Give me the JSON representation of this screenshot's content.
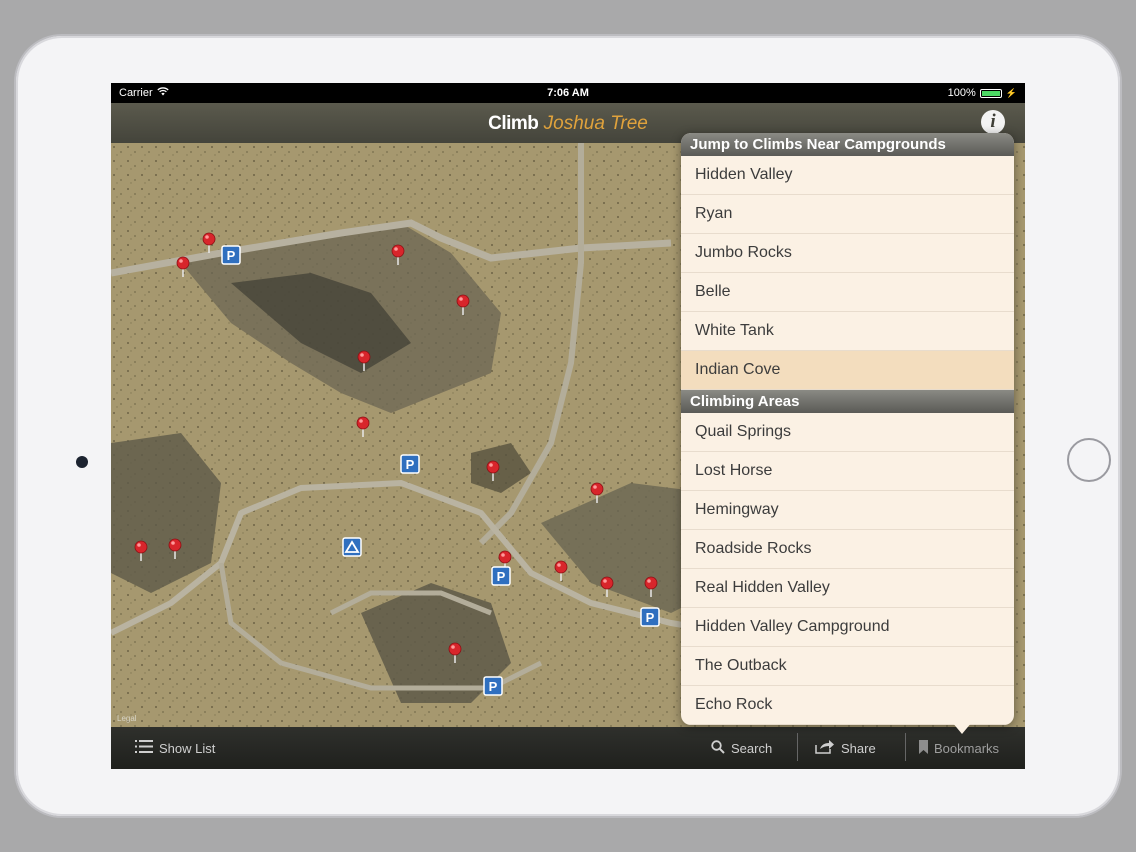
{
  "status_bar": {
    "carrier": "Carrier",
    "time": "7:06 AM",
    "battery": "100%"
  },
  "nav": {
    "title_main": "Climb",
    "title_accent": "Joshua Tree",
    "info_label": "i"
  },
  "toolbar": {
    "show_list": "Show List",
    "search": "Search",
    "share": "Share",
    "bookmarks": "Bookmarks"
  },
  "popover": {
    "campgrounds_header": "Jump to Climbs Near Campgrounds",
    "campgrounds": [
      "Hidden Valley",
      "Ryan",
      "Jumbo Rocks",
      "Belle",
      "White Tank",
      "Indian Cove"
    ],
    "selected_campground": "Indian Cove",
    "areas_header": "Climbing Areas",
    "areas": [
      "Quail Springs",
      "Lost Horse",
      "Hemingway",
      "Roadside Rocks",
      "Real Hidden Valley",
      "Hidden Valley Campground",
      "The Outback",
      "Echo Rock"
    ]
  },
  "map": {
    "legal": "Legal",
    "parking_label": "P"
  },
  "colors": {
    "accent": "#e0a23c",
    "nav_bg": "#4f4e43",
    "popover_bg": "#fbf1e4",
    "selected_row": "#f3ddbe",
    "pin": "#d8252b",
    "parking": "#2f6fbf",
    "terrain": "#a89a72"
  }
}
